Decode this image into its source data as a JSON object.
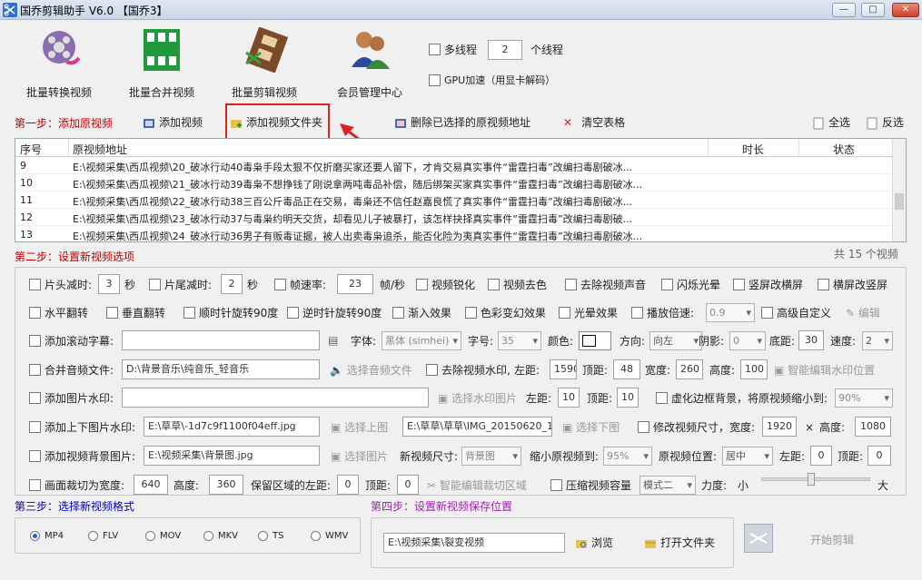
{
  "window": {
    "title": "国乔剪辑助手 V6.0  【国乔3】"
  },
  "toolbar": {
    "items": [
      {
        "label": "批量转换视频"
      },
      {
        "label": "批量合并视频"
      },
      {
        "label": "批量剪辑视频"
      },
      {
        "label": "会员管理中心"
      }
    ],
    "multithread_label": "多线程",
    "thread_count": "2",
    "thread_unit": "个线程",
    "gpu_label": "GPU加速（用显卡解码）"
  },
  "step1": {
    "title": "第一步：添加原视频",
    "add_video": "添加视频",
    "add_folder": "添加视频文件夹",
    "delete_selected": "删除已选择的原视频地址",
    "clear_table": "清空表格",
    "select_all": "全选",
    "invert_select": "反选"
  },
  "table": {
    "headers": [
      "序号",
      "原视频地址",
      "时长",
      "状态"
    ],
    "rows": [
      {
        "no": "9",
        "path": "E:\\视频采集\\西瓜视频\\20_破冰行动40毒枭手段太狠不仅折磨买家还要人留下，才肯交易真实事件“雷霆扫毒”改编扫毒剧破冰..."
      },
      {
        "no": "10",
        "path": "E:\\视频采集\\西瓜视频\\21_破冰行动39毒枭不想挣钱了刚说拿两吨毒品补偿，随后绑架买家真实事件“雷霆扫毒”改编扫毒剧破冰..."
      },
      {
        "no": "11",
        "path": "E:\\视频采集\\西瓜视频\\22_破冰行动38三百公斤毒品正在交易，毒枭还不信任赵嘉良慌了真实事件“雷霆扫毒”改编扫毒剧破冰..."
      },
      {
        "no": "12",
        "path": "E:\\视频采集\\西瓜视频\\23_破冰行动37与毒枭约明天交货，却看见儿子被暴打，该怎样抉择真实事件“雷霆扫毒”改编扫毒剧破..."
      },
      {
        "no": "13",
        "path": "E:\\视频采集\\西瓜视频\\24_破冰行动36男子有贩毒证据，被人出卖毒枭追杀，能否化险为夷真实事件“雷霆扫毒”改编扫毒剧破冰..."
      }
    ],
    "total": "共 15 个视频"
  },
  "step2": {
    "title": "第二步：设置新视频选项",
    "head_cut": "片头减时:",
    "head_val": "3",
    "sec1": "秒",
    "tail_cut": "片尾减时:",
    "tail_val": "2",
    "sec2": "秒",
    "fps": "帧速率:",
    "fps_val": "23",
    "fps_unit": "帧/秒",
    "sharpen": "视频锐化",
    "denoise": "视频去色",
    "mute": "去除视频声音",
    "flash": "闪烁光晕",
    "v2h": "竖屏改横屏",
    "h2v": "横屏改竖屏",
    "hflip": "水平翻转",
    "vflip": "垂直翻转",
    "cw90": "顺时针旋转90度",
    "ccw90": "逆时针旋转90度",
    "fadein": "渐入效果",
    "colorfx": "色彩变幻效果",
    "lightfx": "光晕效果",
    "speed": "播放倍速:",
    "speed_val": "0.9",
    "hd_custom": "高级自定义",
    "edit": "编辑",
    "scroll_sub": "添加滚动字幕:",
    "font": "字体:",
    "font_val": "黑体 (simhei)",
    "fontsize": "字号:",
    "fontsize_val": "35",
    "color": "颜色:",
    "direction": "方向:",
    "direction_val": "向左",
    "shadow": "阴影:",
    "shadow_val": "0",
    "bottom": "底距:",
    "bottom_val": "30",
    "speed2": "速度:",
    "speed2_val": "2",
    "merge_audio": "合并音频文件:",
    "audio_path": "D:\\背景音乐\\纯音乐_轻音乐",
    "choose_audio": "选择音频文件",
    "remove_wm": "去除视频水印,",
    "left": "左距:",
    "wm_left": "1590",
    "top": "顶距:",
    "wm_top": "48",
    "width": "宽度:",
    "wm_width": "260",
    "height": "高度:",
    "wm_height": "100",
    "smart_wm": "智能编辑水印位置",
    "img_wm": "添加图片水印:",
    "choose_wm_img": "选择水印图片",
    "img_left_val": "10",
    "img_top_val": "10",
    "blur_bg": "虚化边框背景，将原视频缩小到:",
    "blur_val": "90%",
    "tb_img": "添加上下图片水印:",
    "top_img": "E:\\草草\\-1d7c9f1100f04eff.jpg",
    "choose_top": "选择上图",
    "bottom_img": "E:\\草草\\草草\\IMG_20150620_104",
    "choose_bottom": "选择下图",
    "resize": "修改视频尺寸，宽度:",
    "resize_w": "1920",
    "times": "×",
    "resize_h_label": "高度:",
    "resize_h": "1080",
    "bg_img": "添加视频背景图片:",
    "bg_path": "E:\\视频采集\\背景图.jpg",
    "choose_img": "选择图片",
    "new_size": "新视频尺寸:",
    "new_size_val": "背景图",
    "shrink": "缩小原视频到:",
    "shrink_val": "95%",
    "orig_pos": "原视频位置:",
    "orig_pos_val": "居中",
    "left2_val": "0",
    "top2_val": "0",
    "crop": "画面裁切为宽度:",
    "crop_w": "640",
    "crop_h_label": "高度:",
    "crop_h": "360",
    "keep_left": "保留区域的左距:",
    "keep_left_val": "0",
    "keep_top_val": "0",
    "smart_crop": "智能编辑裁切区域",
    "compress": "压缩视频容量",
    "compress_mode": "模式二",
    "strength": "力度:",
    "small": "小",
    "big": "大"
  },
  "step3": {
    "title": "第三步：选择新视频格式",
    "formats": [
      "MP4",
      "FLV",
      "MOV",
      "MKV",
      "TS",
      "WMV"
    ],
    "selected": "MP4"
  },
  "step4": {
    "title": "第四步：设置新视频保存位置",
    "path": "E:\\视频采集\\裂变视频",
    "browse": "浏览",
    "open_folder": "打开文件夹",
    "start": "开始剪辑"
  },
  "colors": {
    "step_red": "#c00000",
    "step_purple": "#a020b0",
    "step_blue": "#0000c0",
    "highlight": "#e02020"
  }
}
